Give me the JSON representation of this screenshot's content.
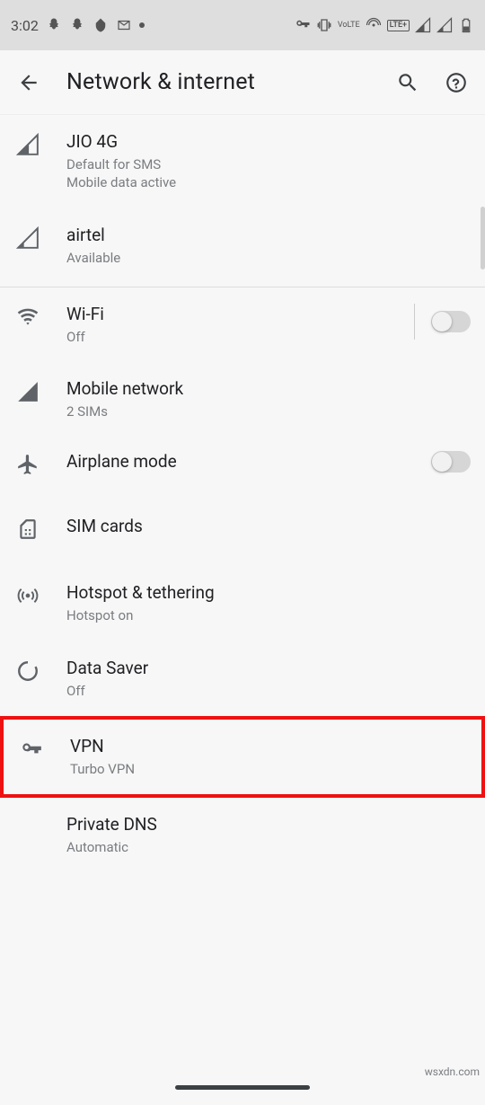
{
  "status": {
    "time": "3:02",
    "lte_label": "LTE+",
    "volte_label": "VoLTE"
  },
  "app_bar": {
    "title": "Network & internet"
  },
  "sims": [
    {
      "name": "JIO 4G",
      "line1": "Default for SMS",
      "line2": "Mobile data active"
    },
    {
      "name": "airtel",
      "line1": "Available"
    }
  ],
  "items": {
    "wifi": {
      "title": "Wi-Fi",
      "subtitle": "Off",
      "toggled": false
    },
    "mobile": {
      "title": "Mobile network",
      "subtitle": "2 SIMs"
    },
    "airplane": {
      "title": "Airplane mode",
      "toggled": false
    },
    "sim": {
      "title": "SIM cards"
    },
    "hotspot": {
      "title": "Hotspot & tethering",
      "subtitle": "Hotspot on"
    },
    "datasaver": {
      "title": "Data Saver",
      "subtitle": "Off"
    },
    "vpn": {
      "title": "VPN",
      "subtitle": "Turbo VPN"
    },
    "dns": {
      "title": "Private DNS",
      "subtitle": "Automatic"
    }
  },
  "watermark": "wsxdn.com"
}
